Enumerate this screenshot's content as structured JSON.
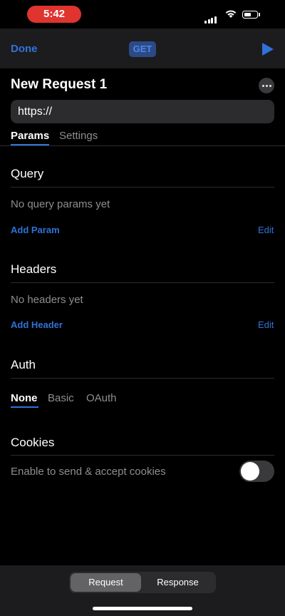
{
  "status_bar": {
    "time": "5:42"
  },
  "nav": {
    "done_label": "Done",
    "method": "GET"
  },
  "request": {
    "title": "New Request 1",
    "url_value": "https://"
  },
  "tabs": [
    {
      "label": "Params"
    },
    {
      "label": "Settings"
    }
  ],
  "query": {
    "title": "Query",
    "empty_text": "No query params yet",
    "add_label": "Add Param",
    "edit_label": "Edit"
  },
  "headers": {
    "title": "Headers",
    "empty_text": "No headers yet",
    "add_label": "Add Header",
    "edit_label": "Edit"
  },
  "auth": {
    "title": "Auth",
    "options": [
      {
        "label": "None"
      },
      {
        "label": "Basic"
      },
      {
        "label": "OAuth"
      }
    ]
  },
  "cookies": {
    "title": "Cookies",
    "toggle_label": "Enable to send & accept cookies",
    "enabled": false
  },
  "bottom_segment": [
    {
      "label": "Request"
    },
    {
      "label": "Response"
    }
  ],
  "colors": {
    "accent": "#2f73d9",
    "background": "#000000",
    "bar": "#1c1c1e",
    "muted_text": "#8e8e93",
    "status_pill": "#e0342f"
  },
  "icons": {
    "play": "play-icon",
    "more": "ellipsis-circle-icon",
    "wifi": "wifi-icon",
    "signal": "signal-icon",
    "battery": "battery-icon"
  }
}
